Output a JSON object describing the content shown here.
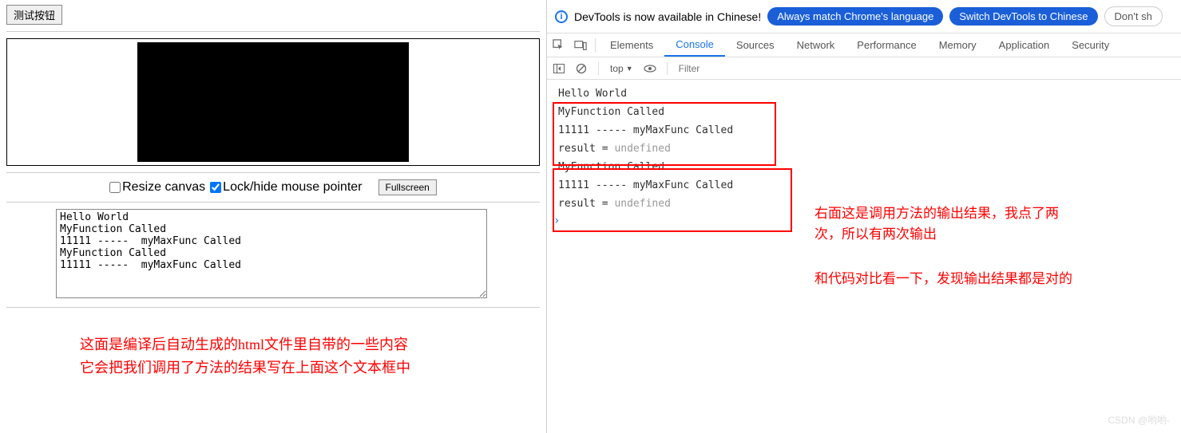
{
  "left": {
    "test_button": "测试按钮",
    "resize_label": "Resize canvas",
    "lock_label": "Lock/hide mouse pointer",
    "fullscreen": "Fullscreen",
    "output": "Hello World\nMyFunction Called\n11111 -----  myMaxFunc Called\nMyFunction Called\n11111 -----  myMaxFunc Called",
    "annotation_l1": "这面是编译后自动生成的html文件里自带的一些内容",
    "annotation_l2": "它会把我们调用了方法的结果写在上面这个文本框中"
  },
  "devtools": {
    "notice_text": "DevTools is now available in Chinese!",
    "pill1": "Always match Chrome's language",
    "pill2": "Switch DevTools to Chinese",
    "pill3": "Don't sh",
    "tabs": [
      "Elements",
      "Console",
      "Sources",
      "Network",
      "Performance",
      "Memory",
      "Application",
      "Security"
    ],
    "active_tab": "Console",
    "context": "top",
    "filter_placeholder": "Filter",
    "logs": [
      {
        "text": "Hello World"
      },
      {
        "text": "MyFunction Called"
      },
      {
        "text": "11111 -----  myMaxFunc Called"
      },
      {
        "prefix": "result = ",
        "undef": "undefined"
      },
      {
        "text": "MyFunction Called"
      },
      {
        "text": "11111 -----  myMaxFunc Called"
      },
      {
        "prefix": "result = ",
        "undef": "undefined"
      }
    ]
  },
  "annot_right_l1": "右面这是调用方法的输出结果，我点了两",
  "annot_right_l2": "次，所以有两次输出",
  "annot_right2": "和代码对比看一下，发现输出结果都是对的",
  "watermark": "CSDN @哟哟-"
}
